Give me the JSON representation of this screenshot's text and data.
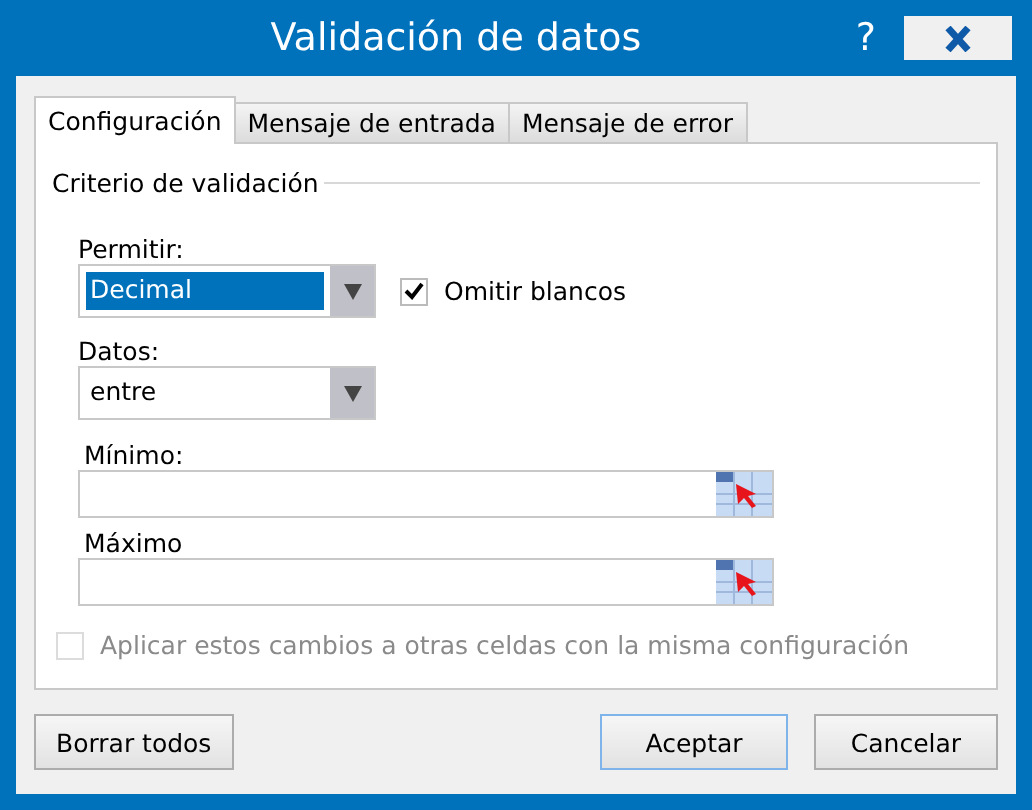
{
  "window": {
    "title": "Validación de datos",
    "help": "?"
  },
  "tabs": [
    {
      "label": "Configuración",
      "selected": true
    },
    {
      "label": "Mensaje de entrada",
      "selected": false
    },
    {
      "label": "Mensaje de error",
      "selected": false
    }
  ],
  "section_title": "Criterio de validación",
  "allow": {
    "label": "Permitir:",
    "value": "Decimal",
    "highlighted": true
  },
  "ignore_blank": {
    "label": "Omitir blancos",
    "checked": true
  },
  "data": {
    "label": "Datos:",
    "value": "entre",
    "highlighted": false
  },
  "ranges": [
    {
      "label": "Mínimo:"
    },
    {
      "label": "Máximo"
    }
  ],
  "apply_all": {
    "label": "Aplicar estos cambios a otras celdas con la misma configuración",
    "checked": false,
    "disabled": true
  },
  "left_buttons": [
    {
      "label": "Borrar todos",
      "default": false
    }
  ],
  "right_buttons": [
    {
      "label": "Aceptar",
      "default": true
    },
    {
      "label": "Cancelar",
      "default": false
    }
  ]
}
